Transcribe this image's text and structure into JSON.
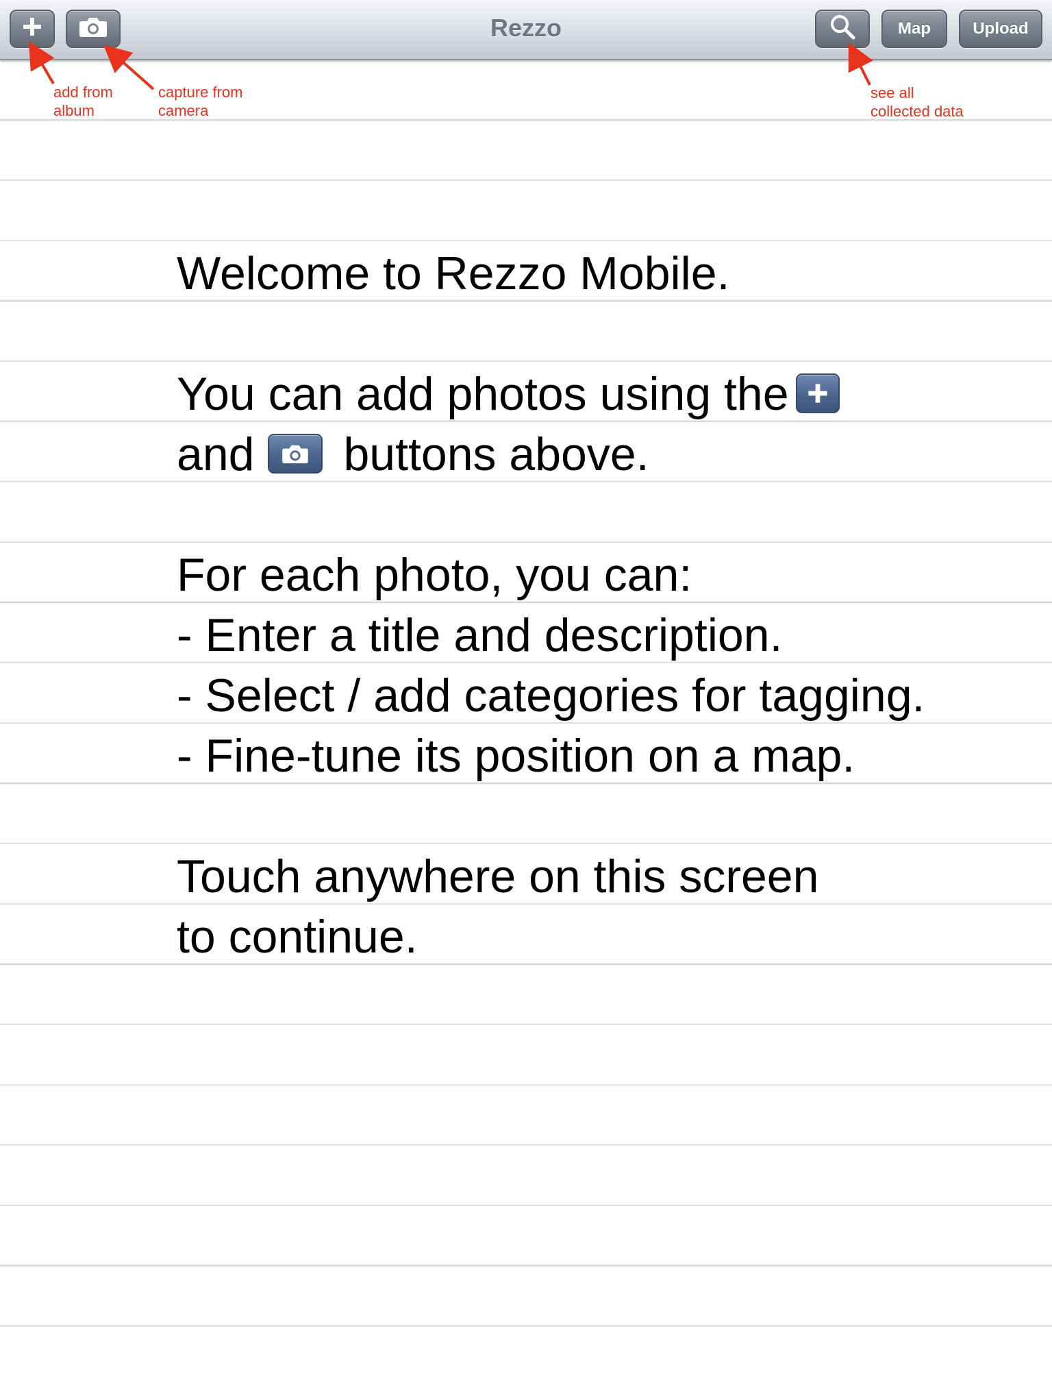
{
  "toolbar": {
    "title": "Rezzo",
    "buttons": {
      "add_icon": "plus-icon",
      "camera_icon": "camera-icon",
      "search_icon": "magnifier-icon",
      "map_label": "Map",
      "upload_label": "Upload"
    }
  },
  "annotations": {
    "add_from_album": [
      "add from",
      "album"
    ],
    "capture_from_camera": [
      "capture from",
      "camera"
    ],
    "see_all_collected_data": [
      "see all",
      "collected data"
    ],
    "color": "#e8321c"
  },
  "main": {
    "welcome": "Welcome to Rezzo Mobile.",
    "add_photos_line1": "You can add photos using the",
    "add_photos_line2_start": "and",
    "add_photos_line2_end": "buttons above.",
    "for_each": "For each photo, you can:",
    "bullets": [
      "- Enter a title and description.",
      "- Select / add categories for tagging.",
      "- Fine-tune its position on a map."
    ],
    "touch_line1": "Touch anywhere on this screen",
    "touch_line2": "to continue."
  },
  "colors": {
    "toolbar_button": "#7a828d",
    "inline_button": "#4e6890",
    "rule_line": "#d9d9d9",
    "title_text": "#6f7680"
  }
}
